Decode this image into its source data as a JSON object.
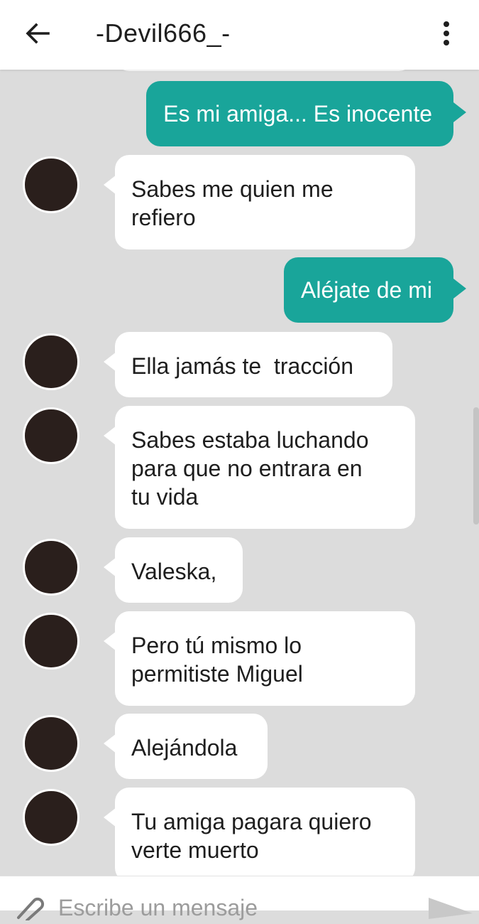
{
  "header": {
    "title": "-Devil666_-",
    "back_icon": "arrow-left-icon",
    "menu_icon": "more-vertical-icon"
  },
  "colors": {
    "outgoing_bubble": "#19a59a",
    "incoming_bubble": "#ffffff",
    "chat_background": "#dcdcdc",
    "header_background": "#ffffff"
  },
  "messages": [
    {
      "direction": "out",
      "text": "Es mi amiga... Es inocente"
    },
    {
      "direction": "in",
      "text": "Sabes me quien me refiero",
      "lines": [
        "Sabes me quien me",
        "refiero"
      ]
    },
    {
      "direction": "out",
      "text": "Aléjate de mi"
    },
    {
      "direction": "in",
      "text": "Ella jamás te  tracción"
    },
    {
      "direction": "in",
      "text": "Sabes estaba luchando para que no entrara en tu vida",
      "lines": [
        "Sabes estaba luchando",
        "para que no entrara en",
        "tu vida"
      ]
    },
    {
      "direction": "in",
      "text": "Valeska,"
    },
    {
      "direction": "in",
      "text": "Pero tú mismo lo permitiste Miguel",
      "lines": [
        "Pero tú mismo lo",
        "permitiste Miguel"
      ]
    },
    {
      "direction": "in",
      "text": "Alejándola"
    },
    {
      "direction": "in",
      "text": "Tu amiga pagara quiero verte muerto",
      "lines": [
        "Tu amiga pagara quiero",
        "verte muerto"
      ]
    }
  ],
  "composer": {
    "placeholder": "Escribe un mensaje",
    "value": "",
    "attach_icon": "paperclip-icon",
    "send_icon": "send-icon"
  }
}
